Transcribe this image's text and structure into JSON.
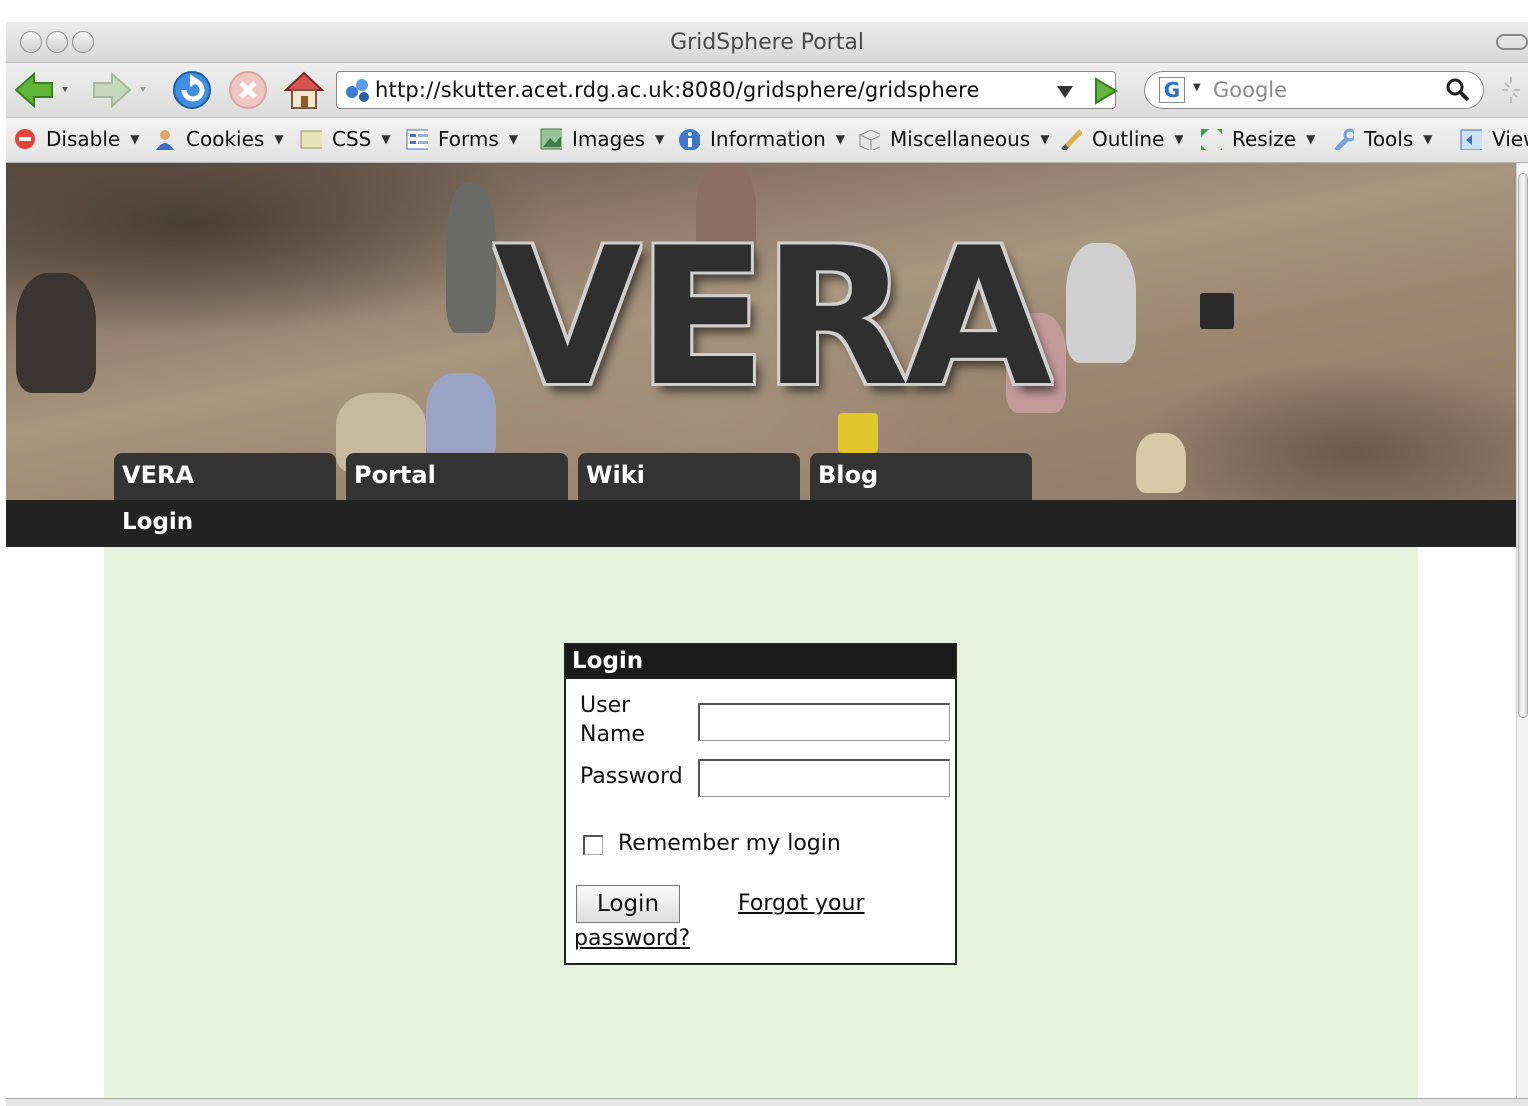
{
  "window": {
    "title": "GridSphere Portal"
  },
  "navbar": {
    "url": "http://skutter.acet.rdg.ac.uk:8080/gridsphere/gridsphere",
    "search_placeholder": "Google"
  },
  "devbar": {
    "items": [
      {
        "label": "Disable",
        "icon": "disable-icon"
      },
      {
        "label": "Cookies",
        "icon": "cookies-icon"
      },
      {
        "label": "CSS",
        "icon": "css-icon"
      },
      {
        "label": "Forms",
        "icon": "forms-icon"
      },
      {
        "label": "Images",
        "icon": "images-icon"
      },
      {
        "label": "Information",
        "icon": "information-icon"
      },
      {
        "label": "Miscellaneous",
        "icon": "miscellaneous-icon"
      },
      {
        "label": "Outline",
        "icon": "outline-icon"
      },
      {
        "label": "Resize",
        "icon": "resize-icon"
      },
      {
        "label": "Tools",
        "icon": "tools-icon"
      },
      {
        "label": "View",
        "icon": "view-icon"
      }
    ]
  },
  "banner": {
    "logo_text": "VERA"
  },
  "tabs": [
    {
      "label": "VERA"
    },
    {
      "label": "Portal"
    },
    {
      "label": "Wiki"
    },
    {
      "label": "Blog"
    }
  ],
  "subnav": {
    "items": [
      {
        "label": "Login"
      }
    ]
  },
  "login": {
    "heading": "Login",
    "username_label_line1": "User",
    "username_label_line2": "Name",
    "password_label": "Password",
    "remember_label": "Remember my login",
    "login_button": "Login",
    "forgot_line1": "Forgot your",
    "forgot_line2": "password?"
  },
  "colors": {
    "content_bg": "#e6f2dc",
    "tab_bg": "#333333",
    "subnav_bg": "#222222"
  }
}
